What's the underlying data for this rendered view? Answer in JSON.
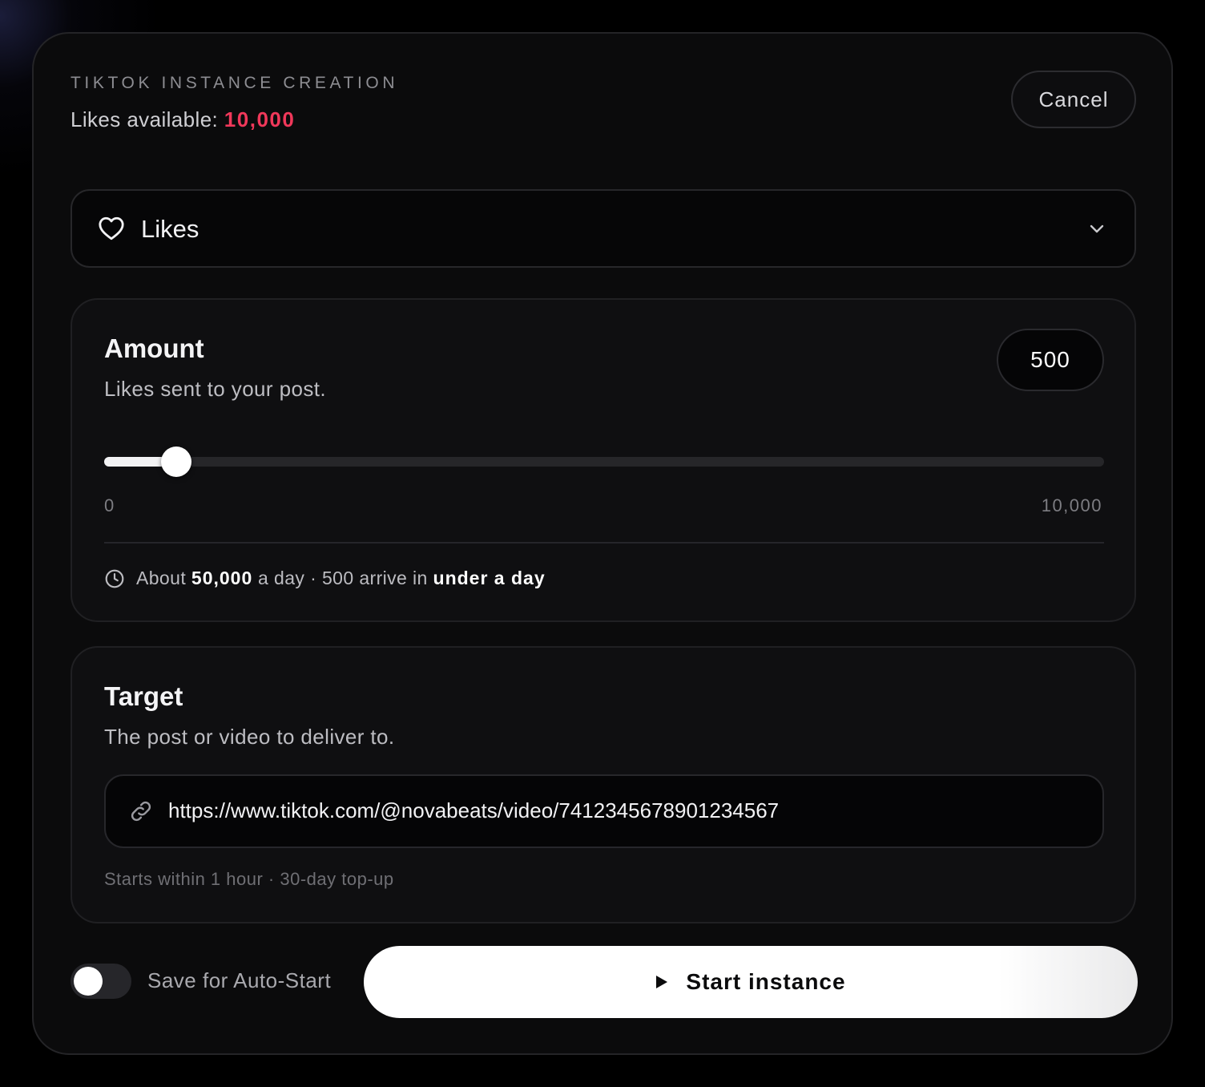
{
  "header": {
    "title": "TIKTOK INSTANCE CREATION",
    "likes_label": "Likes available: ",
    "likes_count": "10,000",
    "cancel_label": "Cancel"
  },
  "service_select": {
    "icon": "heart-icon",
    "selected": "Likes",
    "chevron_icon": "chevron-down-icon"
  },
  "amount": {
    "title": "Amount",
    "subtitle": "Likes sent to your post.",
    "value": "500",
    "slider": {
      "min": 0,
      "max": 10000,
      "value": 500
    },
    "min_label": "0",
    "max_label": "10,000",
    "rate": {
      "icon": "clock-icon",
      "prefix": "About ",
      "per_day": "50,000",
      "middle": " a day · 500 arrive in ",
      "eta": "under a day"
    }
  },
  "target": {
    "title": "Target",
    "subtitle": "The post or video to deliver to.",
    "url_icon": "link-icon",
    "url": "https://www.tiktok.com/@novabeats/video/7412345678901234567",
    "footnote": "Starts within 1 hour · 30-day top-up"
  },
  "footer": {
    "toggle_label": "Save for Auto-Start",
    "toggle_on": false,
    "start_label": "Start instance",
    "start_icon": "play-icon"
  },
  "colors": {
    "accent": "#f0385a",
    "background": "#0b0b0c",
    "card": "#0f0f11"
  }
}
